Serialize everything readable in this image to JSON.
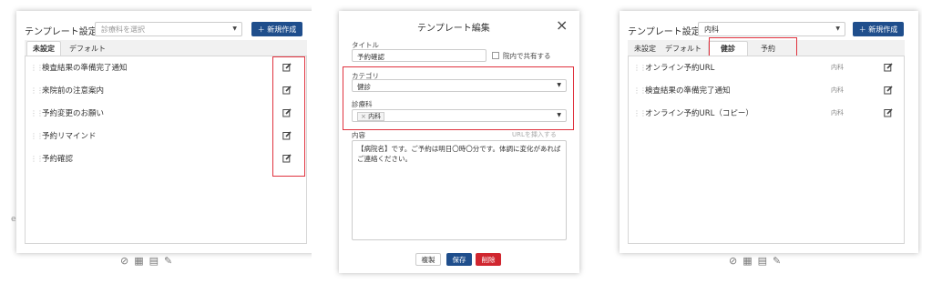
{
  "colors": {
    "primary": "#1f4e8c",
    "danger": "#d0262f",
    "highlight": "#e0323e"
  },
  "screen1": {
    "title": "テンプレート設定",
    "select_placeholder": "診療科を選択",
    "new_button": "＋ 新規作成",
    "tabs": [
      "未設定",
      "デフォルト"
    ],
    "items": [
      "検査結果の準備完了通知",
      "来院前の注意案内",
      "予約変更のお願い",
      "予約リマインド",
      "予約確認"
    ]
  },
  "screen2": {
    "title": "テンプレート編集",
    "close_icon": "×",
    "title_label": "タイトル",
    "title_value": "予約確認",
    "share_label": "院内で共有する",
    "category_label": "カテゴリ",
    "category_value": "健診",
    "dept_label": "診療科",
    "dept_tag": "内科",
    "content_label": "内容",
    "insert_url": "URLを挿入する",
    "content_text": "【病院名】です。ご予約は明日〇時〇分です。体調に変化があればご連絡ください。",
    "btn_copy": "複製",
    "btn_save": "保存",
    "btn_delete": "削除"
  },
  "screen3": {
    "title": "テンプレート設定",
    "select_value": "内科",
    "new_button": "＋ 新規作成",
    "tabs": [
      "未設定",
      "デフォルト",
      "健診",
      "予約"
    ],
    "items": [
      {
        "label": "オンライン予約URL",
        "dept": "内科"
      },
      {
        "label": "検査結果の準備完了通知",
        "dept": "内科"
      },
      {
        "label": "オンライン予約URL（コピー）",
        "dept": "内科"
      }
    ]
  }
}
